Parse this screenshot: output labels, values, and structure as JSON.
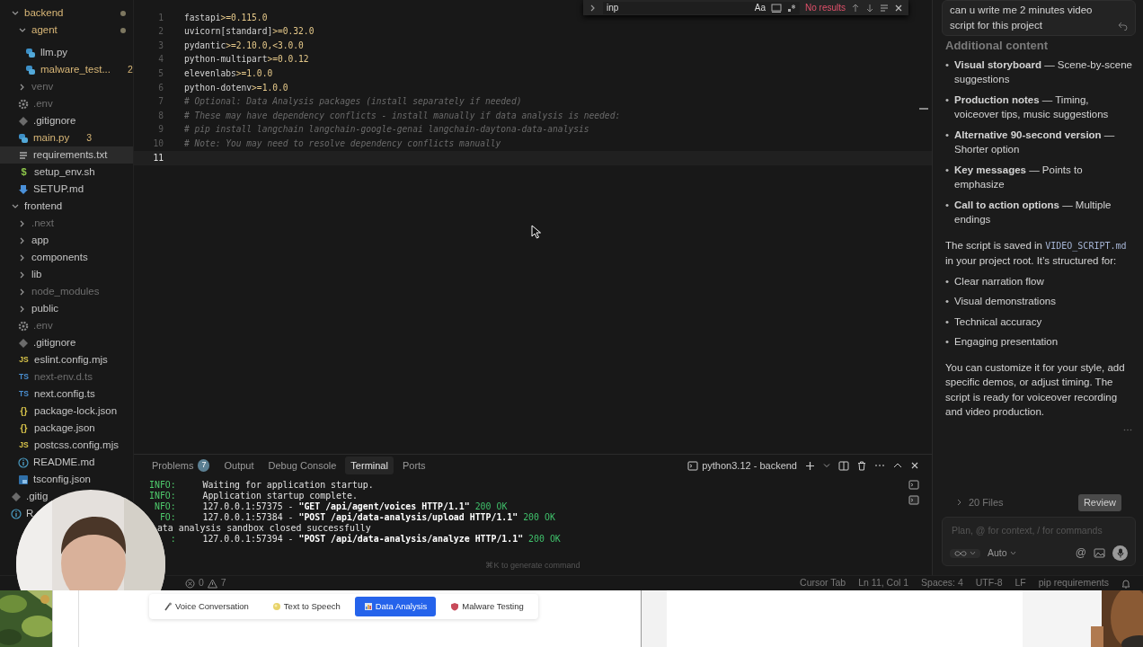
{
  "explorer": {
    "items": [
      {
        "label": "backend",
        "kind": "folder",
        "expanded": true,
        "modified": true,
        "ignored": false,
        "dot": true,
        "selected": false,
        "children": [
          {
            "label": "agent",
            "kind": "folder",
            "expanded": true,
            "modified": true,
            "ignored": false,
            "dot": true,
            "selected": false,
            "children": [
              {
                "label": "llm.py",
                "kind": "python",
                "modified": false,
                "ignored": false,
                "selected": false
              },
              {
                "label": "malware_test...",
                "kind": "python",
                "modified": true,
                "ignored": false,
                "badge": "2",
                "selected": false
              }
            ]
          },
          {
            "label": "venv",
            "kind": "folder",
            "expanded": false,
            "modified": false,
            "ignored": true,
            "selected": false
          },
          {
            "label": ".env",
            "kind": "gear",
            "modified": false,
            "ignored": true,
            "selected": false
          },
          {
            "label": ".gitignore",
            "kind": "diamond",
            "modified": false,
            "ignored": false,
            "selected": false
          },
          {
            "label": "main.py",
            "kind": "python",
            "modified": true,
            "ignored": false,
            "badge": "3",
            "selected": false
          },
          {
            "label": "requirements.txt",
            "kind": "lines",
            "modified": false,
            "ignored": false,
            "selected": true
          },
          {
            "label": "setup_env.sh",
            "kind": "shell",
            "glyph": "$",
            "modified": false,
            "ignored": false,
            "selected": false
          },
          {
            "label": "SETUP.md",
            "kind": "markdown",
            "modified": false,
            "ignored": false,
            "selected": false
          }
        ]
      },
      {
        "label": "frontend",
        "kind": "folder",
        "expanded": true,
        "modified": false,
        "ignored": false,
        "selected": false,
        "children": [
          {
            "label": ".next",
            "kind": "folder",
            "expanded": false,
            "modified": false,
            "ignored": true,
            "selected": false
          },
          {
            "label": "app",
            "kind": "folder",
            "expanded": false,
            "modified": false,
            "ignored": false,
            "selected": false
          },
          {
            "label": "components",
            "kind": "folder",
            "expanded": false,
            "modified": false,
            "ignored": false,
            "selected": false
          },
          {
            "label": "lib",
            "kind": "folder",
            "expanded": false,
            "modified": false,
            "ignored": false,
            "selected": false
          },
          {
            "label": "node_modules",
            "kind": "folder",
            "expanded": false,
            "modified": false,
            "ignored": true,
            "selected": false
          },
          {
            "label": "public",
            "kind": "folder",
            "expanded": false,
            "modified": false,
            "ignored": false,
            "selected": false
          },
          {
            "label": ".env",
            "kind": "gear",
            "modified": false,
            "ignored": true,
            "selected": false
          },
          {
            "label": ".gitignore",
            "kind": "diamond",
            "modified": false,
            "ignored": false,
            "selected": false
          },
          {
            "label": "eslint.config.mjs",
            "kind": "js",
            "glyph": "JS",
            "modified": false,
            "ignored": false,
            "selected": false
          },
          {
            "label": "next-env.d.ts",
            "kind": "ts",
            "glyph": "TS",
            "modified": false,
            "ignored": true,
            "selected": false
          },
          {
            "label": "next.config.ts",
            "kind": "ts",
            "glyph": "TS",
            "modified": false,
            "ignored": false,
            "selected": false
          },
          {
            "label": "package-lock.json",
            "kind": "json",
            "glyph": "{}",
            "modified": false,
            "ignored": false,
            "selected": false
          },
          {
            "label": "package.json",
            "kind": "json",
            "glyph": "{}",
            "modified": false,
            "ignored": false,
            "selected": false
          },
          {
            "label": "postcss.config.mjs",
            "kind": "js",
            "glyph": "JS",
            "modified": false,
            "ignored": false,
            "selected": false
          },
          {
            "label": "README.md",
            "kind": "info",
            "modified": false,
            "ignored": false,
            "selected": false
          },
          {
            "label": "tsconfig.json",
            "kind": "tsconfig",
            "modified": false,
            "ignored": false,
            "selected": false
          }
        ]
      },
      {
        "label": ".gitig",
        "kind": "diamond",
        "modified": false,
        "ignored": false,
        "selected": false
      },
      {
        "label": "R",
        "kind": "info",
        "modified": false,
        "ignored": false,
        "selected": false
      }
    ]
  },
  "find": {
    "value": "inp",
    "case_label": "Aa",
    "status": "No results"
  },
  "code": [
    {
      "number": "1",
      "kind": "requirement",
      "package": "fastapi",
      "spec": ">=0.115.0",
      "current": false
    },
    {
      "number": "2",
      "kind": "requirement",
      "package": "uvicorn[standard]",
      "spec": ">=0.32.0",
      "current": false
    },
    {
      "number": "3",
      "kind": "requirement",
      "package": "pydantic",
      "spec": ">=2.10.0,<3.0.0",
      "current": false
    },
    {
      "number": "4",
      "kind": "requirement",
      "package": "python-multipart",
      "spec": ">=0.0.12",
      "current": false
    },
    {
      "number": "5",
      "kind": "requirement",
      "package": "elevenlabs",
      "spec": ">=1.0.0",
      "current": false
    },
    {
      "number": "6",
      "kind": "requirement",
      "package": "python-dotenv",
      "spec": ">=1.0.0",
      "current": false
    },
    {
      "number": "7",
      "kind": "comment",
      "text": "# Optional: Data Analysis packages (install separately if needed)",
      "current": false
    },
    {
      "number": "8",
      "kind": "comment",
      "text": "# These may have dependency conflicts - install manually if data analysis is needed:",
      "current": false
    },
    {
      "number": "9",
      "kind": "comment",
      "text": "# pip install langchain langchain-google-genai langchain-daytona-data-analysis",
      "current": false
    },
    {
      "number": "10",
      "kind": "comment",
      "text": "# Note: You may need to resolve dependency conflicts manually",
      "current": false
    },
    {
      "number": "11",
      "kind": "blank",
      "current": true
    }
  ],
  "panel": {
    "tabs": [
      {
        "label": "Problems",
        "badge": "7",
        "selected": false
      },
      {
        "label": "Output",
        "selected": false
      },
      {
        "label": "Debug Console",
        "selected": false
      },
      {
        "label": "Terminal",
        "selected": true
      },
      {
        "label": "Ports",
        "selected": false
      }
    ],
    "shell": "python3.12 - backend",
    "lines": [
      {
        "kind": "log",
        "prefix": "INFO:",
        "text": "Waiting for application startup."
      },
      {
        "kind": "log",
        "prefix": "INFO:",
        "text": "Application startup complete."
      },
      {
        "kind": "log",
        "prefix": "NFO:",
        "text": "127.0.0.1:57375 - ",
        "request": "\"GET /api/agent/voices HTTP/1.1\"",
        "status": "200 OK"
      },
      {
        "kind": "log",
        "prefix": "FO:",
        "text": "127.0.0.1:57384 - ",
        "request": "\"POST /api/data-analysis/upload HTTP/1.1\"",
        "status": "200 OK"
      },
      {
        "kind": "plain",
        "text": "ata analysis sandbox closed successfully"
      },
      {
        "kind": "log",
        "prefix": ":",
        "text": "127.0.0.1:57394 - ",
        "request": "\"POST /api/data-analysis/analyze HTTP/1.1\"",
        "status": "200 OK"
      }
    ],
    "hint": "⌘K to generate command"
  },
  "status_bar": {
    "errors": "0",
    "warnings": "7",
    "items": [
      "Cursor Tab",
      "Ln 11, Col 1",
      "Spaces: 4",
      "UTF-8",
      "LF",
      "pip requirements"
    ]
  },
  "chat": {
    "message": "can u write me 2 minutes video script for this project",
    "heading": "Additional content",
    "blocks": [
      {
        "kind": "bullets",
        "marker": "•",
        "items": [
          "**Visual storyboard** — Scene-by-scene suggestions",
          "**Production notes** — Timing, voiceover tips, music suggestions",
          "**Alternative 90-second version** — Shorter option",
          "**Key messages** — Points to emphasize",
          "**Call to action options** — Multiple endings"
        ]
      },
      {
        "kind": "paragraph",
        "parts": [
          {
            "kind": "text",
            "text": "The script is saved in "
          },
          {
            "kind": "code",
            "text": "VIDEO_SCRIPT.md"
          },
          {
            "kind": "text",
            "text": " in your project root. It’s structured for:"
          }
        ]
      },
      {
        "kind": "bullets",
        "marker": "•",
        "items": [
          "Clear narration flow",
          "Visual demonstrations",
          "Technical accuracy",
          "Engaging presentation"
        ]
      },
      {
        "kind": "paragraph",
        "parts": [
          {
            "kind": "text",
            "text": "You can customize it for your style, add specific demos, or adjust timing. The script is ready for voiceover recording and video production."
          }
        ]
      }
    ],
    "files": "20 Files",
    "review": "Review",
    "placeholder": "Plan, @ for context, / for commands",
    "mode": "Auto",
    "context_button": "@"
  },
  "app_tabs": [
    {
      "label": "Voice Conversation",
      "selected": false
    },
    {
      "label": "Text to Speech",
      "selected": false
    },
    {
      "label": "Data Analysis",
      "selected": true
    },
    {
      "label": "Malware Testing",
      "selected": false
    }
  ]
}
